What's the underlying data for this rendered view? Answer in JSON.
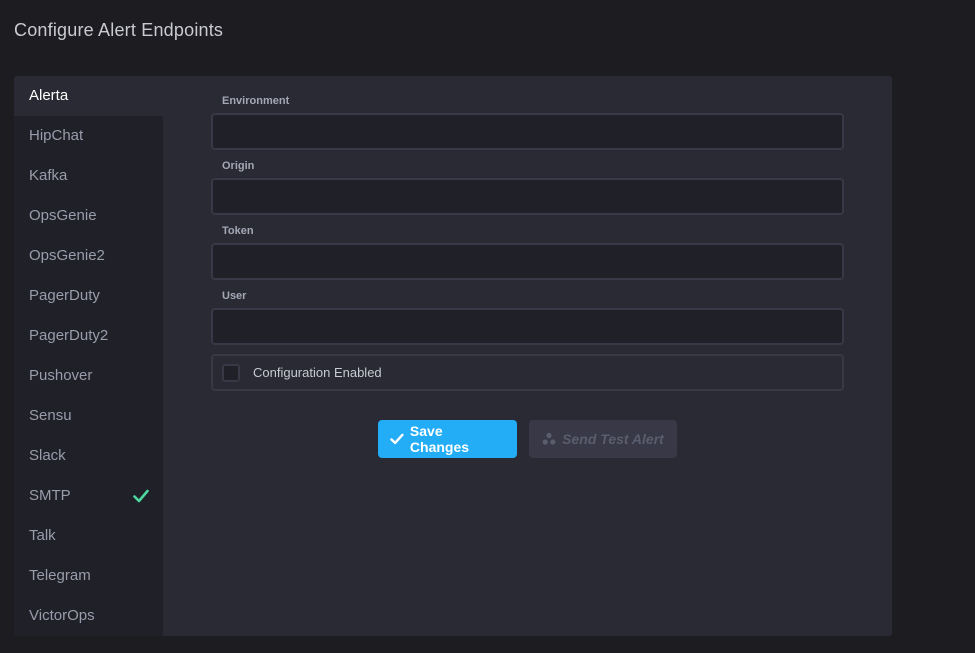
{
  "page": {
    "title": "Configure Alert Endpoints"
  },
  "sidebar": {
    "items": [
      {
        "label": "Alerta",
        "active": true
      },
      {
        "label": "HipChat"
      },
      {
        "label": "Kafka"
      },
      {
        "label": "OpsGenie"
      },
      {
        "label": "OpsGenie2"
      },
      {
        "label": "PagerDuty"
      },
      {
        "label": "PagerDuty2"
      },
      {
        "label": "Pushover"
      },
      {
        "label": "Sensu"
      },
      {
        "label": "Slack"
      },
      {
        "label": "SMTP",
        "configured": true
      },
      {
        "label": "Talk"
      },
      {
        "label": "Telegram"
      },
      {
        "label": "VictorOps"
      }
    ]
  },
  "form": {
    "environment": {
      "label": "Environment",
      "value": ""
    },
    "origin": {
      "label": "Origin",
      "value": ""
    },
    "token": {
      "label": "Token",
      "value": ""
    },
    "user": {
      "label": "User",
      "value": ""
    },
    "enabled": {
      "label": "Configuration Enabled",
      "checked": false
    }
  },
  "actions": {
    "save_label": "Save Changes",
    "test_label": "Send Test Alert"
  },
  "colors": {
    "accent": "#22adf6",
    "success": "#4ed8a0",
    "background": "#1c1c21",
    "panel": "#292a33",
    "sidebar": "#202028"
  },
  "icons": {
    "save": "check-icon",
    "test": "nodes-icon",
    "configured": "check-icon"
  }
}
